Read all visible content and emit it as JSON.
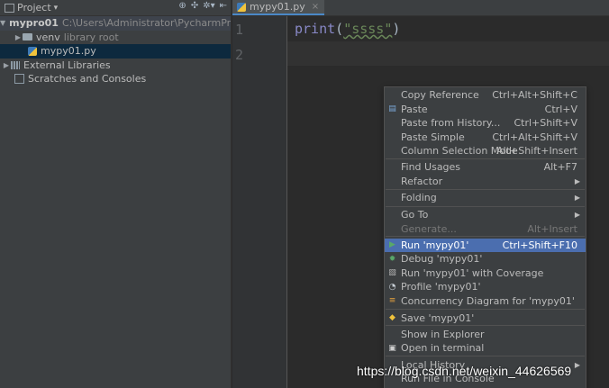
{
  "project_panel": {
    "title": "Project",
    "title_arrow": "▾",
    "tree": {
      "root": {
        "name": "mypro01",
        "path": "C:\\Users\\Administrator\\PycharmProjects\\m"
      },
      "venv": {
        "name": "venv",
        "note": "library root"
      },
      "file": {
        "name": "mypy01.py"
      },
      "external": {
        "name": "External Libraries"
      },
      "scratches": {
        "name": "Scratches and Consoles"
      }
    }
  },
  "editor": {
    "tab": {
      "label": "mypy01.py",
      "close": "×"
    },
    "line_numbers": [
      "1",
      "2"
    ],
    "code": {
      "keyword": "print",
      "open": "(",
      "string": "\"ssss\"",
      "close": ")"
    }
  },
  "context_menu": {
    "items": [
      {
        "label": "Copy Reference",
        "shortcut": "Ctrl+Alt+Shift+C"
      },
      {
        "label": "Paste",
        "shortcut": "Ctrl+V",
        "icon": "paste-icon"
      },
      {
        "label": "Paste from History...",
        "shortcut": "Ctrl+Shift+V"
      },
      {
        "label": "Paste Simple",
        "shortcut": "Ctrl+Alt+Shift+V"
      },
      {
        "label": "Column Selection Mode",
        "shortcut": "Alt+Shift+Insert"
      },
      {
        "label": "Find Usages",
        "shortcut": "Alt+F7"
      },
      {
        "label": "Refactor",
        "submenu": true
      },
      {
        "label": "Folding",
        "submenu": true
      },
      {
        "label": "Go To",
        "submenu": true
      },
      {
        "label": "Generate...",
        "shortcut": "Alt+Insert",
        "disabled": true
      },
      {
        "label": "Run 'mypy01'",
        "shortcut": "Ctrl+Shift+F10",
        "icon": "run-icon",
        "highlighted": true
      },
      {
        "label": "Debug 'mypy01'",
        "icon": "debug-icon"
      },
      {
        "label": "Run 'mypy01' with Coverage",
        "icon": "coverage-icon"
      },
      {
        "label": "Profile 'mypy01'",
        "icon": "profile-icon"
      },
      {
        "label": "Concurrency Diagram for 'mypy01'",
        "icon": "concurrency-icon"
      },
      {
        "label": "Save 'mypy01'",
        "icon": "python-icon"
      },
      {
        "label": "Show in Explorer"
      },
      {
        "label": "Open in terminal",
        "icon": "terminal-icon"
      },
      {
        "label": "Local History",
        "submenu": true
      },
      {
        "label": "Run File in Console"
      }
    ],
    "submenu_arrow": "▶"
  },
  "watermark": "https://blog.csdn.net/weixin_44626569",
  "colors": {
    "accent": "#4b6eaf",
    "panel": "#3c3f41",
    "editor": "#2b2b2b"
  }
}
